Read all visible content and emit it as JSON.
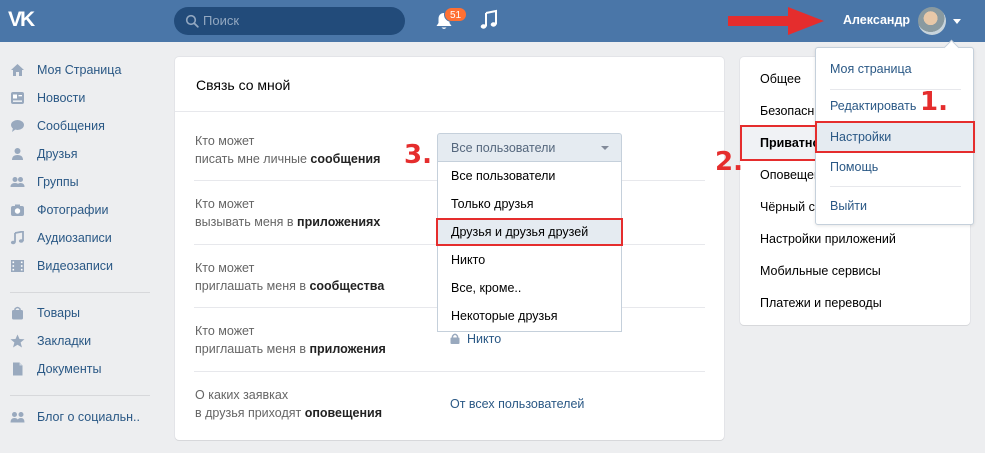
{
  "header": {
    "logo": "VK",
    "search_placeholder": "Поиск",
    "notification_count": "51",
    "user_name": "Александр"
  },
  "sidebar": {
    "items": [
      {
        "label": "Моя Страница",
        "icon": "home-icon"
      },
      {
        "label": "Новости",
        "icon": "news-icon"
      },
      {
        "label": "Сообщения",
        "icon": "messages-icon"
      },
      {
        "label": "Друзья",
        "icon": "friends-icon"
      },
      {
        "label": "Группы",
        "icon": "groups-icon"
      },
      {
        "label": "Фотографии",
        "icon": "camera-icon"
      },
      {
        "label": "Аудиозаписи",
        "icon": "music-icon"
      },
      {
        "label": "Видеозаписи",
        "icon": "video-icon"
      },
      {
        "label": "Товары",
        "icon": "bag-icon"
      },
      {
        "label": "Закладки",
        "icon": "star-icon"
      },
      {
        "label": "Документы",
        "icon": "document-icon"
      },
      {
        "label": "Блог о социальн..",
        "icon": "community-icon"
      }
    ]
  },
  "card": {
    "title": "Связь со мной",
    "rows": [
      {
        "q1": "Кто может",
        "q2": "писать мне личные ",
        "q_bold": "сообщения",
        "answer": ""
      },
      {
        "q1": "Кто может",
        "q2": "вызывать меня в ",
        "q_bold": "приложениях",
        "answer": ""
      },
      {
        "q1": "Кто может",
        "q2": "приглашать меня в ",
        "q_bold": "сообщества",
        "answer": ""
      },
      {
        "q1": "Кто может",
        "q2": "приглашать меня в ",
        "q_bold": "приложения",
        "answer": "Никто"
      },
      {
        "q1": "О каких заявках",
        "q2": "в друзья приходят ",
        "q_bold": "оповещения",
        "answer": "От всех пользователей"
      }
    ]
  },
  "privacy_select": {
    "selected": "Все пользователи",
    "options": [
      "Все пользователи",
      "Только друзья",
      "Друзья и друзья друзей",
      "Никто",
      "Все, кроме..",
      "Некоторые друзья"
    ]
  },
  "settings_menu": {
    "items": [
      "Общее",
      "Безопасн",
      "Приватно",
      "Оповещен",
      "Чёрный с",
      "Настройки приложений",
      "Мобильные сервисы",
      "Платежи и переводы"
    ]
  },
  "user_menu": {
    "items": [
      "Моя страница",
      "Редактировать",
      "Настройки",
      "Помощь",
      "Выйти"
    ]
  },
  "annotations": {
    "step1": "1.",
    "step2": "2.",
    "step3": "3."
  },
  "colors": {
    "header": "#4a76a8",
    "link": "#2a5885",
    "highlight": "#e52d2d",
    "background": "#edeef0"
  }
}
